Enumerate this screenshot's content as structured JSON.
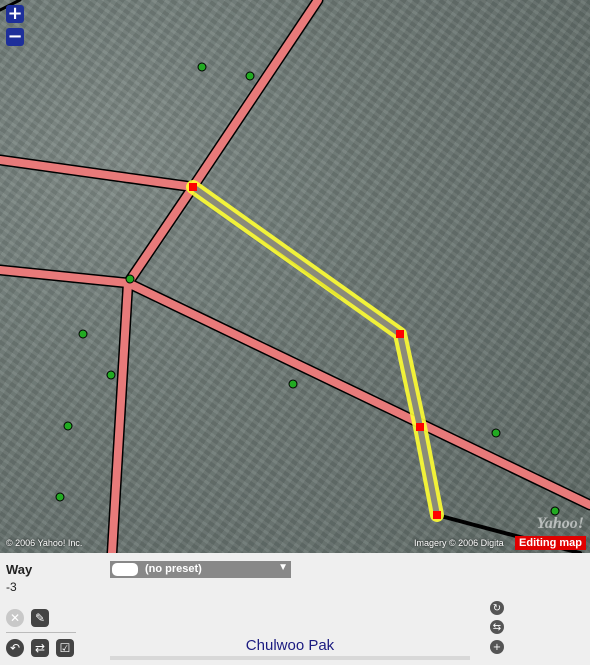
{
  "map": {
    "zoom_in_label": "+",
    "zoom_out_label": "−",
    "copyright": "© 2006 Yahoo! Inc.",
    "imagery_credit": "Imagery © 2006 Digita",
    "yahoo_logo": "Yahoo!",
    "editing_badge": "Editing map"
  },
  "panel": {
    "title": "Way",
    "way_id": "-3",
    "preset_label": "(no preset)",
    "name_value": "Chulwoo Pak"
  },
  "colors": {
    "road_fill": "#e87a7a",
    "road_casing": "#000000",
    "selected_highlight": "#ffff33",
    "node": "#ff0000",
    "poi": "#22aa22",
    "badge": "#e00000"
  },
  "icons": {
    "vehicle": "car-icon",
    "delete": "delete-icon",
    "pencil": "pencil-icon",
    "undo": "undo-icon",
    "reverse": "reverse-icon",
    "tag_check": "checkbox-icon",
    "history": "history-icon",
    "repeat": "repeat-tags-icon",
    "add": "add-tag-icon"
  }
}
